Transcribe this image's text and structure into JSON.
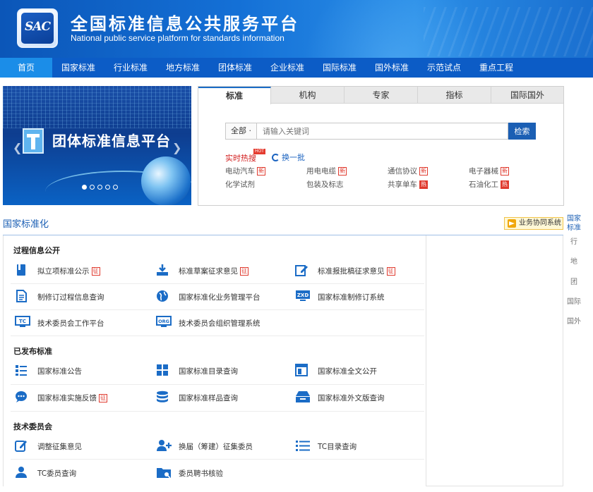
{
  "header": {
    "logo_text": "SAC",
    "title": "全国标准信息公共服务平台",
    "subtitle": "National public service platform  for standards information"
  },
  "nav": {
    "items": [
      {
        "label": "首页"
      },
      {
        "label": "国家标准"
      },
      {
        "label": "行业标准"
      },
      {
        "label": "地方标准"
      },
      {
        "label": "团体标准"
      },
      {
        "label": "企业标准"
      },
      {
        "label": "国际标准"
      },
      {
        "label": "国外标准"
      },
      {
        "label": "示范试点"
      },
      {
        "label": "重点工程"
      }
    ],
    "active_index": 0
  },
  "banner": {
    "title": "团体标准信息平台",
    "slides": 5,
    "active_slide": 0
  },
  "search": {
    "tabs": [
      {
        "label": "标准"
      },
      {
        "label": "机构"
      },
      {
        "label": "专家"
      },
      {
        "label": "指标"
      },
      {
        "label": "国际国外"
      }
    ],
    "active_tab": 0,
    "scope_label": "全部 ·",
    "placeholder": "请输入关键词",
    "button_label": "检索",
    "hot_label": "实时热搜",
    "hot_badge": "HOT",
    "refresh_label": "换一批",
    "keywords": [
      {
        "text": "电动汽车",
        "tag": "新",
        "tag_type": "new"
      },
      {
        "text": "用电电缆",
        "tag": "新",
        "tag_type": "new"
      },
      {
        "text": "通信协议",
        "tag": "新",
        "tag_type": "new"
      },
      {
        "text": "电子器械",
        "tag": "新",
        "tag_type": "new"
      },
      {
        "text": "化学试剂",
        "tag": "",
        "tag_type": ""
      },
      {
        "text": "包装及标志",
        "tag": "",
        "tag_type": ""
      },
      {
        "text": "共享单车",
        "tag": "热",
        "tag_type": "hot"
      },
      {
        "text": "石油化工",
        "tag": "热",
        "tag_type": "hot"
      }
    ]
  },
  "section": {
    "title": "国家标准化",
    "biz_button": "业务协同系统"
  },
  "side_tabs": [
    {
      "label": "国家\n标准"
    },
    {
      "label": "行"
    },
    {
      "label": "地"
    },
    {
      "label": "团"
    },
    {
      "label": "国际"
    },
    {
      "label": "国外"
    }
  ],
  "groups": [
    {
      "title": "过程信息公开",
      "items": [
        {
          "label": "拟立项标准公示",
          "tag": "征",
          "icon": "book-icon"
        },
        {
          "label": "标准草案征求意见",
          "tag": "征",
          "icon": "download-icon"
        },
        {
          "label": "标准报批稿征求意见",
          "tag": "征",
          "icon": "edit-icon"
        },
        {
          "label": "制修订过程信息查询",
          "tag": "",
          "icon": "document-icon"
        },
        {
          "label": "国家标准化业务管理平台",
          "tag": "",
          "icon": "globe-icon"
        },
        {
          "label": "国家标准制修订系统",
          "tag": "",
          "icon": "zxd-monitor-icon"
        },
        {
          "label": "技术委员会工作平台",
          "tag": "",
          "icon": "tc-monitor-icon"
        },
        {
          "label": "技术委员会组织管理系统",
          "tag": "",
          "icon": "org-monitor-icon"
        }
      ]
    },
    {
      "title": "已发布标准",
      "items": [
        {
          "label": "国家标准公告",
          "tag": "",
          "icon": "list-icon"
        },
        {
          "label": "国家标准目录查询",
          "tag": "",
          "icon": "grid-icon"
        },
        {
          "label": "国家标准全文公开",
          "tag": "",
          "icon": "layout-icon"
        },
        {
          "label": "国家标准实施反馈",
          "tag": "征",
          "icon": "chat-icon"
        },
        {
          "label": "国家标准样品查询",
          "tag": "",
          "icon": "database-icon"
        },
        {
          "label": "国家标准外文版查询",
          "tag": "",
          "icon": "inbox-icon"
        }
      ]
    },
    {
      "title": "技术委员会",
      "items": [
        {
          "label": "调整征集意见",
          "tag": "",
          "icon": "edit-square-icon"
        },
        {
          "label": "换届（筹建）征集委员",
          "tag": "",
          "icon": "add-user-icon"
        },
        {
          "label": "TC目录查询",
          "tag": "",
          "icon": "bullet-list-icon"
        },
        {
          "label": "TC委员查询",
          "tag": "",
          "icon": "user-icon"
        },
        {
          "label": "委员聘书核验",
          "tag": "",
          "icon": "folder-icon"
        }
      ]
    }
  ],
  "colors": {
    "brand_blue": "#0c5cc6",
    "nav_active": "#1b8de8",
    "icon_blue": "#1b6cc6",
    "tag_red": "#e03a2e"
  }
}
